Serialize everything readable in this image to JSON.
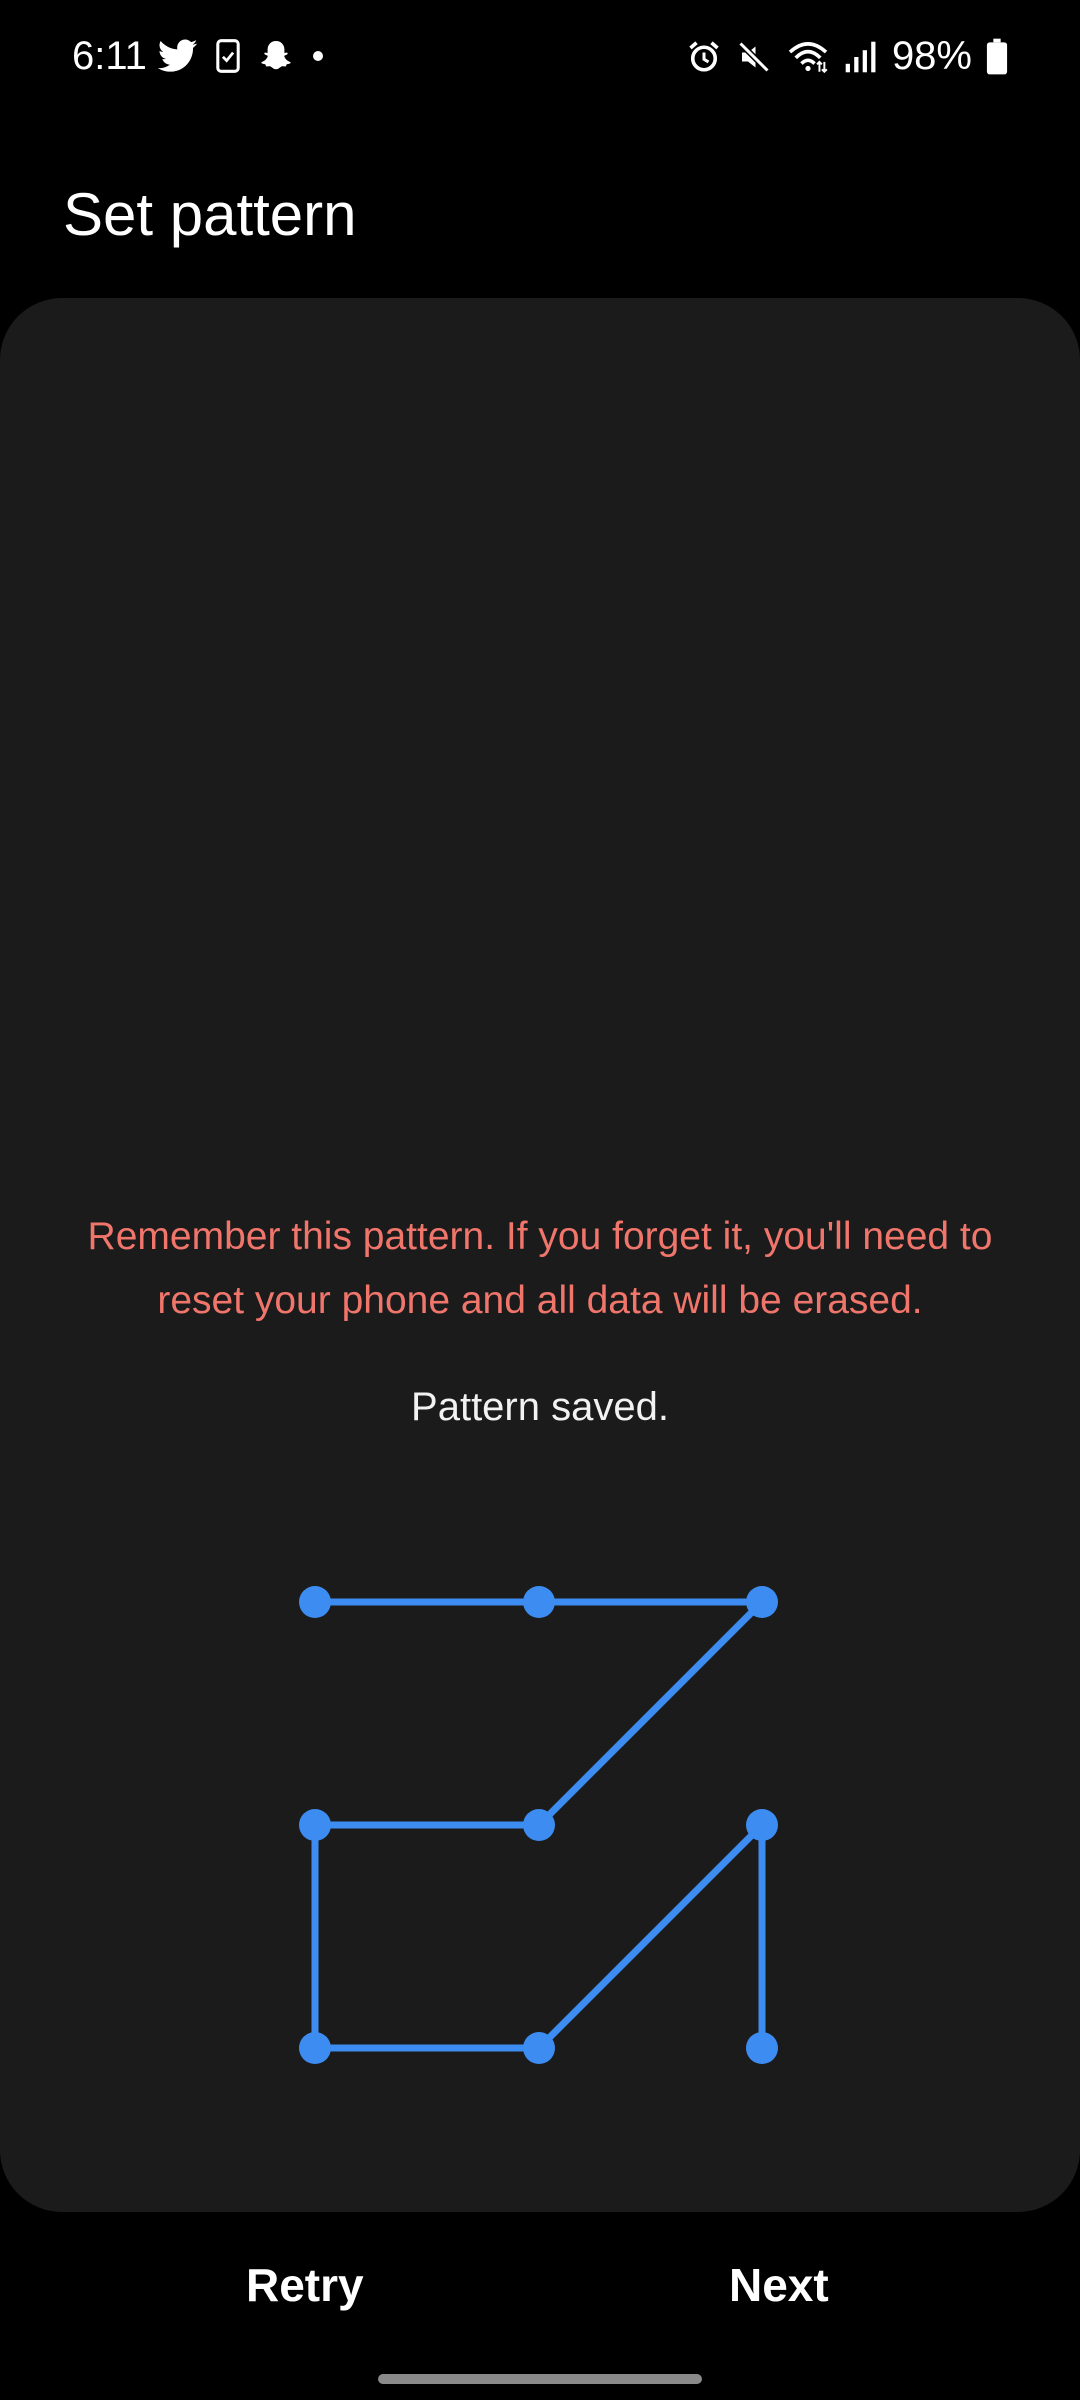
{
  "status_bar": {
    "time": "6:11",
    "left_icons": [
      "twitter-icon",
      "phone-check-icon",
      "snapchat-icon",
      "notification-dot-icon"
    ],
    "right_icons": [
      "alarm-icon",
      "mute-icon",
      "wifi-icon",
      "signal-icon",
      "battery-icon"
    ],
    "battery_percent": "98%"
  },
  "header": {
    "title": "Set pattern"
  },
  "main": {
    "warning": "Remember this pattern. If you forget it, you'll need to reset your phone and all data will be erased.",
    "status_message": "Pattern saved.",
    "pattern": {
      "grid": "3x3",
      "sequence": [
        1,
        2,
        3,
        5,
        4,
        7,
        8,
        6,
        9
      ],
      "color": "#3d8cf2"
    }
  },
  "footer": {
    "retry_label": "Retry",
    "next_label": "Next"
  },
  "colors": {
    "background": "#000000",
    "card": "#1b1b1c",
    "warning": "#f0756b",
    "accent": "#3d8cf2"
  }
}
